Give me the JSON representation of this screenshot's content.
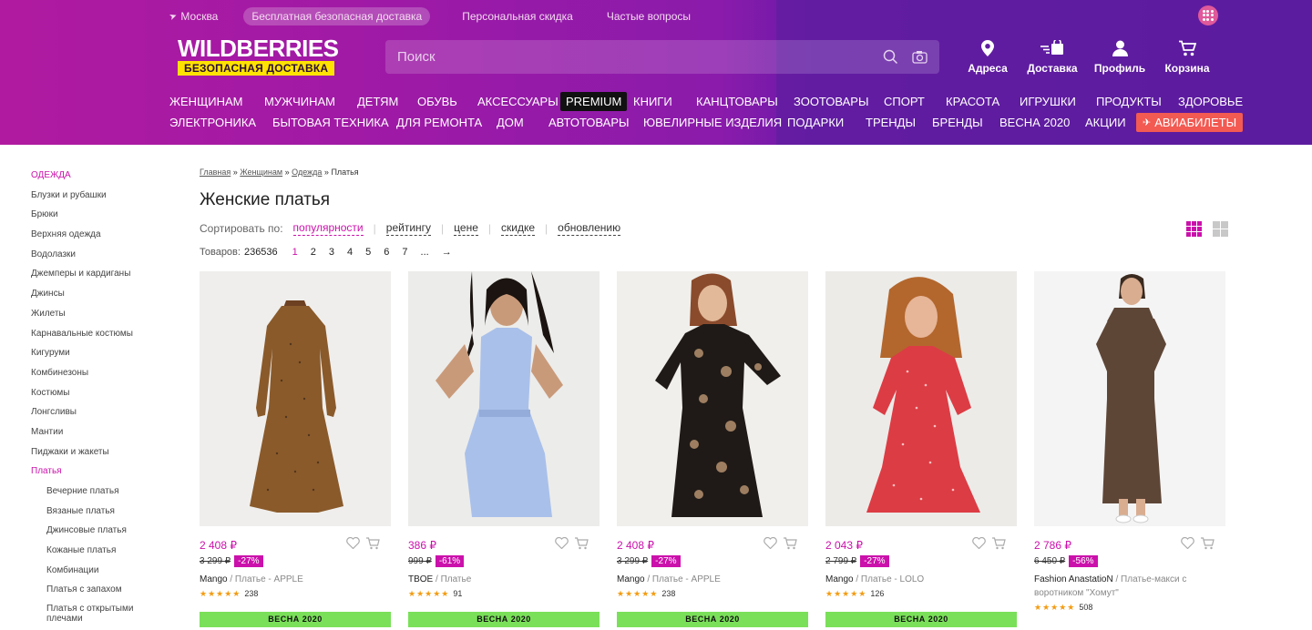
{
  "topbar": {
    "city": "Москва",
    "delivery": "Бесплатная безопасная доставка",
    "discount": "Персональная скидка",
    "faq": "Частые вопросы"
  },
  "logo": {
    "brand": "WILDBERRIES",
    "tagline": "БЕЗОПАСНАЯ ДОСТАВКА"
  },
  "search": {
    "placeholder": "Поиск"
  },
  "actions": [
    {
      "label": "Адреса",
      "icon": "location-pin-icon"
    },
    {
      "label": "Доставка",
      "icon": "delivery-icon"
    },
    {
      "label": "Профиль",
      "icon": "profile-icon"
    },
    {
      "label": "Корзина",
      "icon": "cart-icon"
    }
  ],
  "nav_row1": [
    "ЖЕНЩИНАМ",
    "МУЖЧИНАМ",
    "ДЕТЯМ",
    "ОБУВЬ",
    "АКСЕССУАРЫ",
    "PREMIUM",
    "КНИГИ",
    "КАНЦТОВАРЫ",
    "ЗООТОВАРЫ",
    "СПОРТ",
    "КРАСОТА",
    "ИГРУШКИ",
    "ПРОДУКТЫ",
    "ЗДОРОВЬЕ"
  ],
  "nav_row2": [
    "ЭЛЕКТРОНИКА",
    "БЫТОВАЯ ТЕХНИКА",
    "ДЛЯ РЕМОНТА",
    "ДОМ",
    "АВТОТОВАРЫ",
    "ЮВЕЛИРНЫЕ ИЗДЕЛИЯ",
    "ПОДАРКИ",
    "ТРЕНДЫ",
    "БРЕНДЫ",
    "ВЕСНА 2020",
    "АКЦИИ",
    "АВИАБИЛЕТЫ"
  ],
  "sidebar": {
    "head": "ОДЕЖДА",
    "items": [
      "Блузки и рубашки",
      "Брюки",
      "Верхняя одежда",
      "Водолазки",
      "Джемперы и кардиганы",
      "Джинсы",
      "Жилеты",
      "Карнавальные костюмы",
      "Кигуруми",
      "Комбинезоны",
      "Костюмы",
      "Лонгсливы",
      "Мантии",
      "Пиджаки и жакеты"
    ],
    "active": "Платья",
    "sub": [
      "Вечерние платья",
      "Вязаные платья",
      "Джинсовые платья",
      "Кожаные платья",
      "Комбинации",
      "Платья с запахом",
      "Платья с открытыми плечами"
    ]
  },
  "crumbs": {
    "home": "Главная",
    "women": "Женщинам",
    "clothes": "Одежда",
    "current": "Платья",
    "sep": "»"
  },
  "page_title": "Женские платья",
  "sort": {
    "label": "Сортировать по:",
    "options": [
      "популярности",
      "рейтингу",
      "цене",
      "скидке",
      "обновлению"
    ]
  },
  "count": {
    "label": "Товаров:",
    "value": "236536"
  },
  "pages": [
    "1",
    "2",
    "3",
    "4",
    "5",
    "6",
    "7",
    "...",
    "→"
  ],
  "products": [
    {
      "price": "2 408 ₽",
      "old": "3 299 ₽",
      "discount": "-27%",
      "brand": "Mango",
      "name": "/ Платье - APPLE",
      "reviews": "238",
      "badge": "ВЕСНА 2020",
      "stars": "★★★★★"
    },
    {
      "price": "386 ₽",
      "old": "999 ₽",
      "discount": "-61%",
      "brand": "TBOE",
      "name": "/ Платье",
      "reviews": "91",
      "badge": "ВЕСНА 2020",
      "stars": "★★★★★"
    },
    {
      "price": "2 408 ₽",
      "old": "3 299 ₽",
      "discount": "-27%",
      "brand": "Mango",
      "name": "/ Платье - APPLE",
      "reviews": "238",
      "badge": "ВЕСНА 2020",
      "stars": "★★★★★"
    },
    {
      "price": "2 043 ₽",
      "old": "2 799 ₽",
      "discount": "-27%",
      "brand": "Mango",
      "name": "/ Платье - LOLO",
      "reviews": "126",
      "badge": "ВЕСНА 2020",
      "stars": "★★★★★"
    },
    {
      "price": "2 786 ₽",
      "old": "6 450 ₽",
      "discount": "-56%",
      "brand": "Fashion AnastatioN",
      "name": "/ Платье-макси с воротником \"Хомут\"",
      "reviews": "508",
      "badge": "",
      "stars": "★★★★★"
    }
  ],
  "colors": {
    "accent": "#cb11ab",
    "badge": "#7ae05a",
    "avia": "#f25a52",
    "star": "#f39c12"
  }
}
